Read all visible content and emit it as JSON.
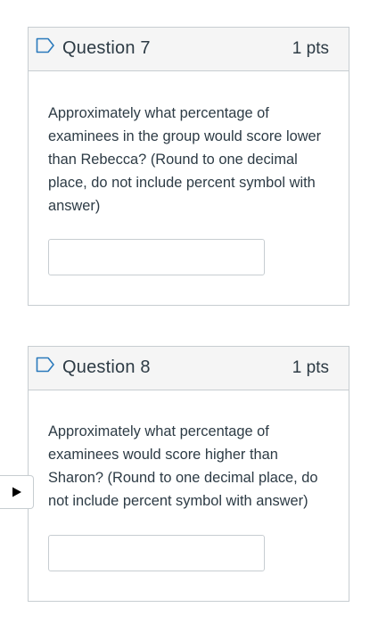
{
  "questions": [
    {
      "title": "Question 7",
      "points": "1 pts",
      "text": "Approximately what percentage of examinees in the group would score lower than Rebecca? (Round to one decimal place, do not include percent symbol with answer)",
      "answer_value": ""
    },
    {
      "title": "Question 8",
      "points": "1 pts",
      "text": "Approximately what percentage of examinees would score higher than Sharon?  (Round to one decimal place, do not include percent symbol with answer)",
      "answer_value": ""
    }
  ],
  "icons": {
    "flag": "flag-outline-icon",
    "side_toggle": "play-triangle-icon"
  },
  "colors": {
    "header_bg": "#f5f5f5",
    "border": "#c7cdd1",
    "flag_blue": "#2b7abc",
    "text": "#2d3b45"
  }
}
